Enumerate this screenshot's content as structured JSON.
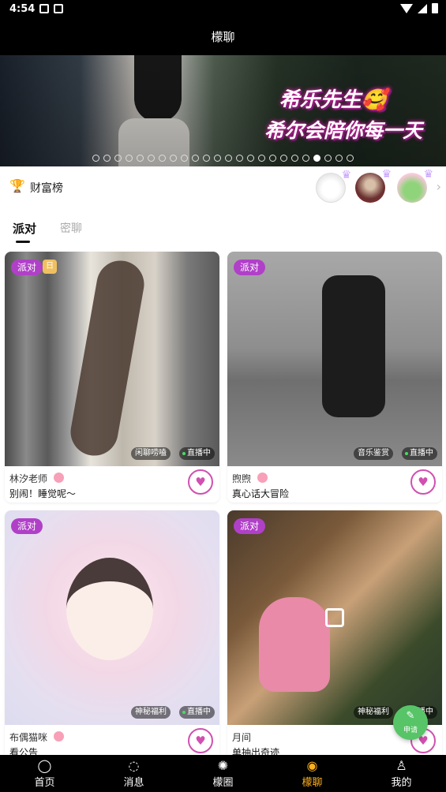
{
  "status_bar": {
    "time": "4:54"
  },
  "header": {
    "title": "檬聊"
  },
  "banner": {
    "line1": "希乐先生🥰",
    "line2": "希尔会陪你每一天",
    "dot_count": 24,
    "active_dot_index": 20
  },
  "rank": {
    "label": "财富榜",
    "trophy_icon": "trophy-icon"
  },
  "tabs": [
    {
      "label": "派对",
      "active": true
    },
    {
      "label": "密聊",
      "active": false
    }
  ],
  "cards": [
    {
      "tag": "派对",
      "extra_badge": "日",
      "topic": "闲聊唠嗑",
      "status": "直播中",
      "name": "林汐老师",
      "desc": "别闹！睡觉呢～"
    },
    {
      "tag": "派对",
      "topic": "音乐鉴赏",
      "status": "直播中",
      "name": "煦煦",
      "desc": "真心话大冒险"
    },
    {
      "tag": "派对",
      "topic": "神秘福利",
      "status": "直播中",
      "name": "布偶猫咪",
      "desc": "看公告"
    },
    {
      "tag": "派对",
      "topic": "神秘福利",
      "status": "直播中",
      "name": "月间",
      "desc": "单抽出奇迹"
    }
  ],
  "fab": {
    "label": "申请"
  },
  "bottom_nav": [
    {
      "label": "首页",
      "icon": "home-icon",
      "active": false
    },
    {
      "label": "消息",
      "icon": "message-icon",
      "active": false
    },
    {
      "label": "檬圈",
      "icon": "circle-icon",
      "active": false
    },
    {
      "label": "檬聊",
      "icon": "chat-icon",
      "active": true
    },
    {
      "label": "我的",
      "icon": "profile-icon",
      "active": false
    }
  ],
  "colors": {
    "accent": "#ffb020",
    "tag_purple": "#b040c8",
    "heart_pink": "#d050b0",
    "fab_green": "#58c468"
  }
}
